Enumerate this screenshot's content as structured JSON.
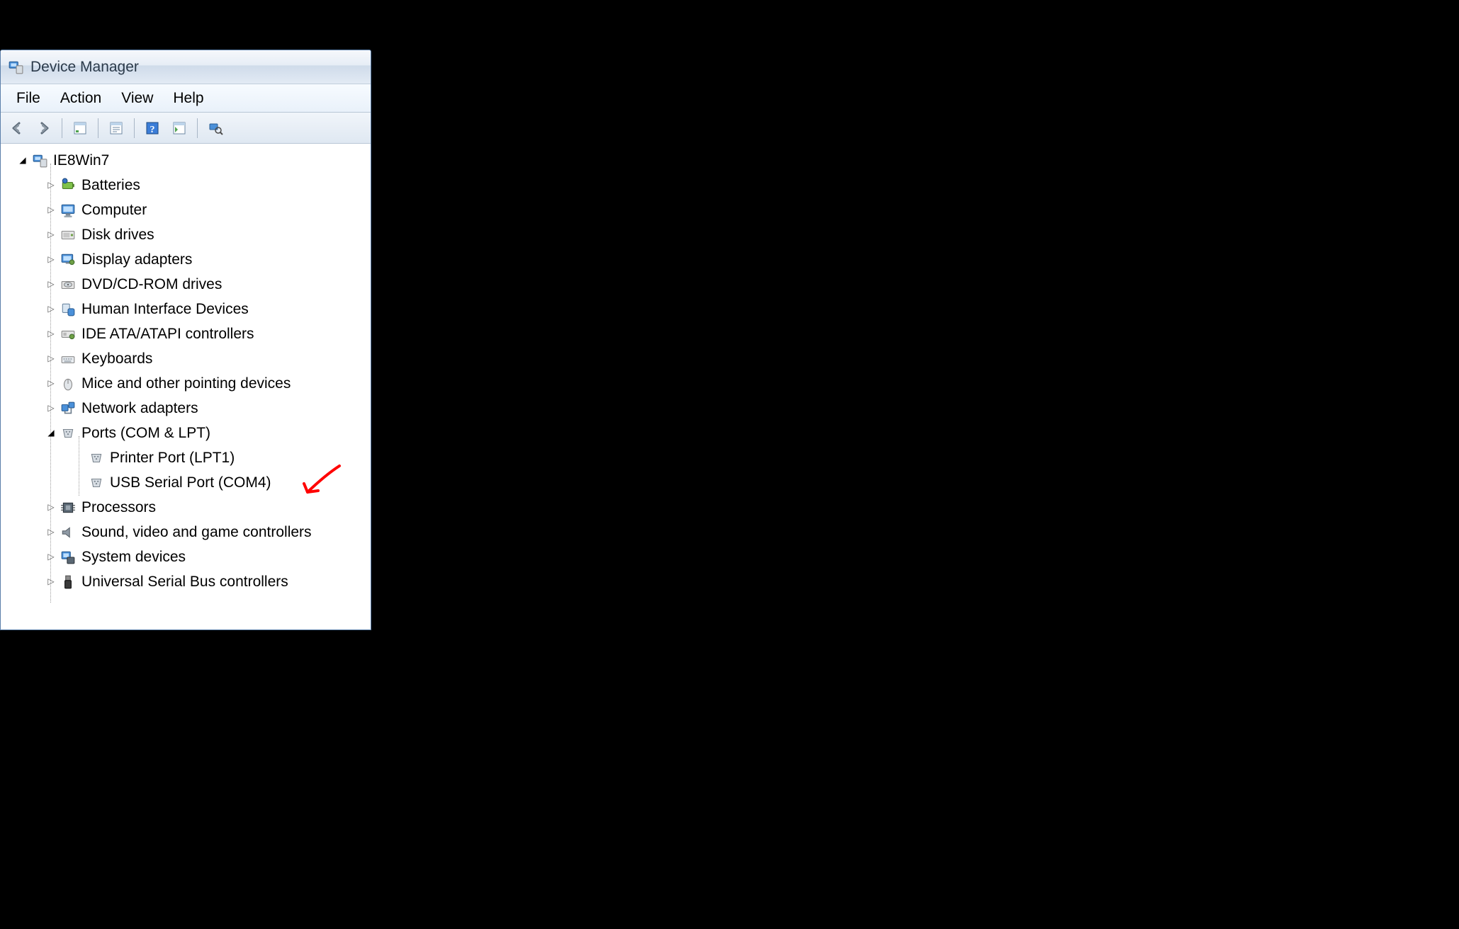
{
  "window": {
    "title": "Device Manager"
  },
  "menu": {
    "file": "File",
    "action": "Action",
    "view": "View",
    "help": "Help"
  },
  "toolbar_icons": {
    "back": "back-arrow-icon",
    "forward": "forward-arrow-icon",
    "show_hidden": "show-hidden-icon",
    "properties": "properties-icon",
    "help": "help-icon",
    "scan": "scan-hardware-icon",
    "update": "update-driver-icon"
  },
  "tree": {
    "root": "IE8Win7",
    "nodes": [
      {
        "label": "Batteries"
      },
      {
        "label": "Computer"
      },
      {
        "label": "Disk drives"
      },
      {
        "label": "Display adapters"
      },
      {
        "label": "DVD/CD-ROM drives"
      },
      {
        "label": "Human Interface Devices"
      },
      {
        "label": "IDE ATA/ATAPI controllers"
      },
      {
        "label": "Keyboards"
      },
      {
        "label": "Mice and other pointing devices"
      },
      {
        "label": "Network adapters"
      },
      {
        "label": "Ports (COM & LPT)"
      },
      {
        "label": "Processors"
      },
      {
        "label": "Sound, video and game controllers"
      },
      {
        "label": "System devices"
      },
      {
        "label": "Universal Serial Bus controllers"
      }
    ],
    "ports_children": [
      {
        "label": "Printer Port (LPT1)"
      },
      {
        "label": "USB Serial Port (COM4)"
      }
    ]
  }
}
